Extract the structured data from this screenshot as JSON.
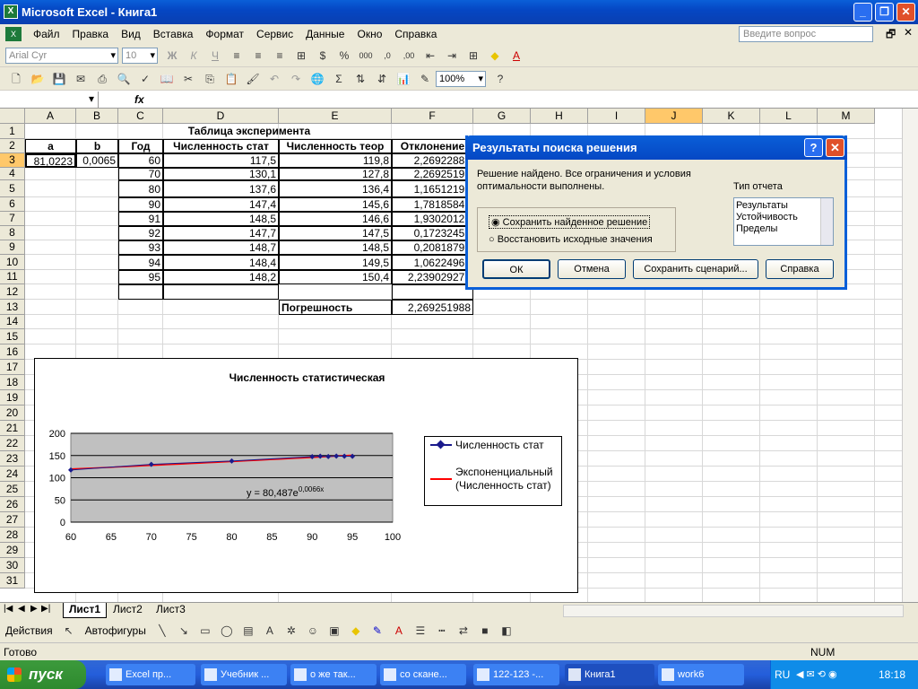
{
  "app": {
    "title": "Microsoft Excel - Книга1"
  },
  "menu": [
    "Файл",
    "Правка",
    "Вид",
    "Вставка",
    "Формат",
    "Сервис",
    "Данные",
    "Окно",
    "Справка"
  ],
  "question_placeholder": "Введите вопрос",
  "toolbar": {
    "font": "Arial Cyr",
    "size": "10",
    "zoom": "100%"
  },
  "columns": [
    "A",
    "B",
    "C",
    "D",
    "E",
    "F",
    "G",
    "H",
    "I",
    "J",
    "K",
    "L",
    "M"
  ],
  "rows": [
    "1",
    "2",
    "3",
    "4",
    "5",
    "6",
    "7",
    "8",
    "9",
    "10",
    "11",
    "12",
    "13",
    "14",
    "15",
    "16",
    "17",
    "18",
    "19",
    "20",
    "21",
    "22",
    "23",
    "24",
    "25",
    "26",
    "27",
    "28",
    "29",
    "30",
    "31"
  ],
  "sheet": {
    "title": "Таблица эксперимента",
    "headers": [
      "a",
      "b",
      "Год",
      "Численность стат",
      "Численность теор",
      "Отклонение"
    ],
    "a_val": "81,0223",
    "b_val": "0,0065",
    "data": [
      [
        "60",
        "117,5",
        "119,8",
        "2,26922886"
      ],
      [
        "70",
        "130,1",
        "127,8",
        "2,26925198"
      ],
      [
        "80",
        "137,6",
        "136,4",
        "1,16512192"
      ],
      [
        "90",
        "147,4",
        "145,6",
        "1,78185848"
      ],
      [
        "91",
        "148,5",
        "146,6",
        "1,93020120"
      ],
      [
        "92",
        "147,7",
        "147,5",
        "0,17232457"
      ],
      [
        "93",
        "148,7",
        "148,5",
        "0,20818793"
      ],
      [
        "94",
        "148,4",
        "149,5",
        "1,06224962"
      ],
      [
        "95",
        "148,2",
        "150,4",
        "2,239029272"
      ]
    ],
    "error_label": "Погрешность",
    "error_val": "2,269251988"
  },
  "chart_data": {
    "type": "scatter",
    "title": "Численность статистическая",
    "xlim": [
      60,
      100
    ],
    "ylim": [
      0,
      200
    ],
    "xticks": [
      "60",
      "65",
      "70",
      "75",
      "80",
      "85",
      "90",
      "95",
      "100"
    ],
    "yticks": [
      "0",
      "50",
      "100",
      "150",
      "200"
    ],
    "series": [
      {
        "name": "Численность стат",
        "color": "#1a1a8c",
        "x": [
          60,
          70,
          80,
          90,
          91,
          92,
          93,
          94,
          95
        ],
        "y": [
          117.5,
          130.1,
          137.6,
          147.4,
          148.5,
          147.7,
          148.7,
          148.4,
          148.2
        ]
      }
    ],
    "trend": {
      "name": "Экспоненциальный (Численность стат)",
      "color": "#ff0000",
      "equation": "y = 80,487e",
      "exp": "0,0066x"
    }
  },
  "dialog": {
    "title": "Результаты поиска решения",
    "message": "Решение найдено. Все ограничения и условия оптимальности выполнены.",
    "report_label": "Тип отчета",
    "reports": [
      "Результаты",
      "Устойчивость",
      "Пределы"
    ],
    "opt_keep": "Сохранить найденное решение",
    "opt_restore": "Восстановить исходные значения",
    "btn_ok": "ОК",
    "btn_cancel": "Отмена",
    "btn_save": "Сохранить сценарий...",
    "btn_help": "Справка"
  },
  "tabs": [
    "Лист1",
    "Лист2",
    "Лист3"
  ],
  "drawbar": {
    "actions": "Действия",
    "autoshapes": "Автофигуры"
  },
  "status": {
    "ready": "Готово",
    "num": "NUM"
  },
  "taskbar": {
    "start": "пуск",
    "tasks": [
      "Excel пр...",
      "Учебник ...",
      "о же так...",
      "со скане...",
      "122-123 -...",
      "Книга1",
      "work6"
    ],
    "lang": "RU",
    "time": "18:18"
  }
}
